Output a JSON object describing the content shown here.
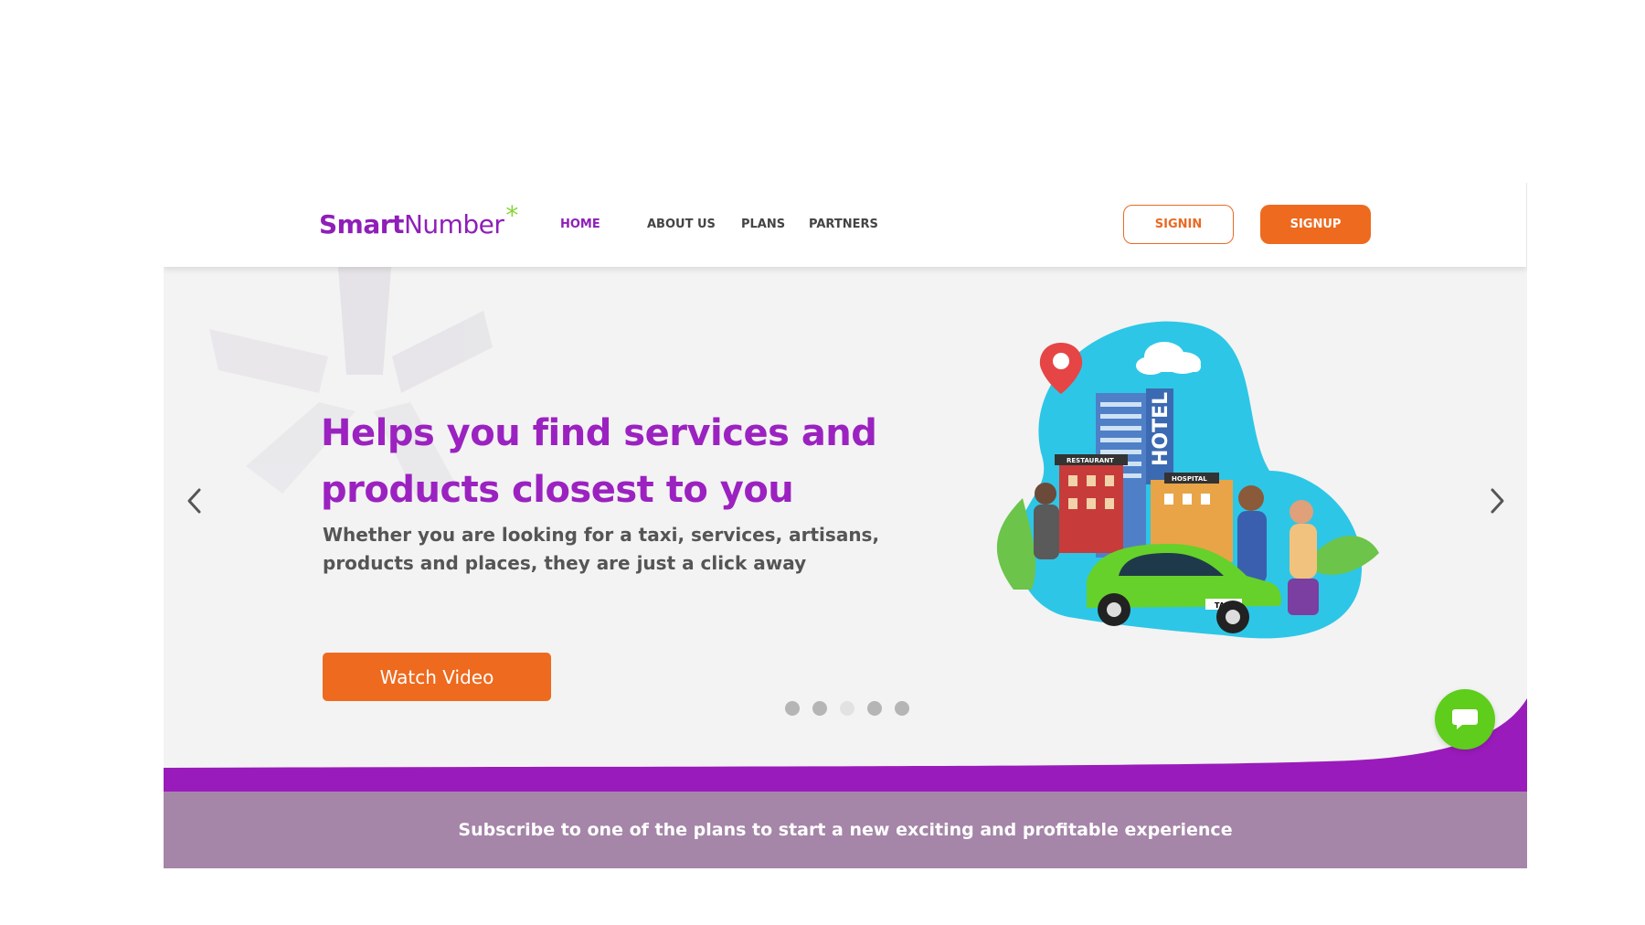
{
  "header": {
    "logo": {
      "part1": "Smart",
      "part2": "Number",
      "mark": "*"
    },
    "nav": [
      {
        "label": "HOME",
        "active": true
      },
      {
        "label": "ABOUT US",
        "active": false
      },
      {
        "label": "PLANS",
        "active": false
      },
      {
        "label": "PARTNERS",
        "active": false
      }
    ],
    "signin_label": "SIGNIN",
    "signup_label": "SIGNUP"
  },
  "hero": {
    "title": "Helps you find services and products closest to you",
    "subtitle": "Whether you are looking for a taxi, services, artisans, products and places, they are just a click away",
    "watch_label": "Watch Video",
    "slides": {
      "count": 5,
      "active_index": 2
    },
    "illustration_labels": {
      "hotel": "HOTEL",
      "restaurant": "RESTAURANT",
      "hospital": "HOSPITAL",
      "taxi": "TAXI"
    },
    "icons": {
      "prev": "chevron-left-icon",
      "next": "chevron-right-icon",
      "pin": "location-pin-icon"
    }
  },
  "subscribe": {
    "text": "Subscribe to one of the plans to start a new exciting and profitable experience"
  },
  "chat": {
    "icon": "chat-bubble-icon"
  },
  "colors": {
    "brand_purple": "#9b22c0",
    "accent_orange": "#ee6a1e",
    "logo_green": "#8ad43a",
    "chat_green": "#5fcd1b",
    "subscribe_bar": "#a585a8"
  }
}
